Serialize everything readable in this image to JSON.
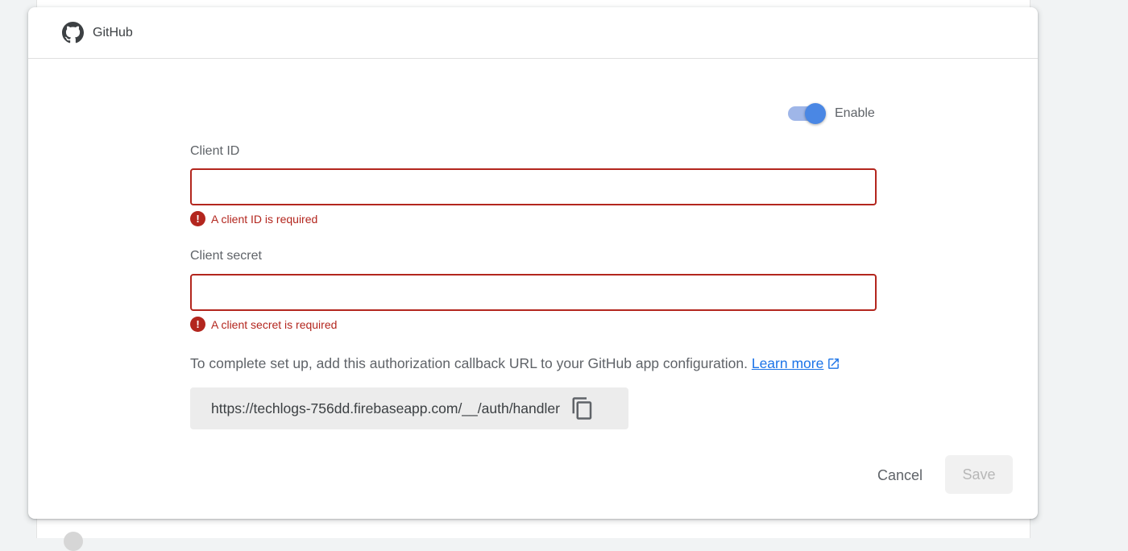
{
  "provider": {
    "name": "GitHub",
    "icon": "github-icon"
  },
  "enable_toggle": {
    "label": "Enable",
    "enabled": true,
    "accent": "#4a87e4"
  },
  "client_id": {
    "label": "Client ID",
    "value": "",
    "error": "A client ID is required"
  },
  "client_secret": {
    "label": "Client secret",
    "value": "",
    "error": "A client secret is required"
  },
  "callback": {
    "instruction": "To complete set up, add this authorization callback URL to your GitHub app configuration.",
    "learn_more": "Learn more",
    "url": "https://techlogs-756dd.firebaseapp.com/__/auth/handler",
    "copy_icon": "copy-icon"
  },
  "actions": {
    "cancel": "Cancel",
    "save": "Save"
  },
  "colors": {
    "error": "#b3261e",
    "link": "#1a73e8"
  }
}
